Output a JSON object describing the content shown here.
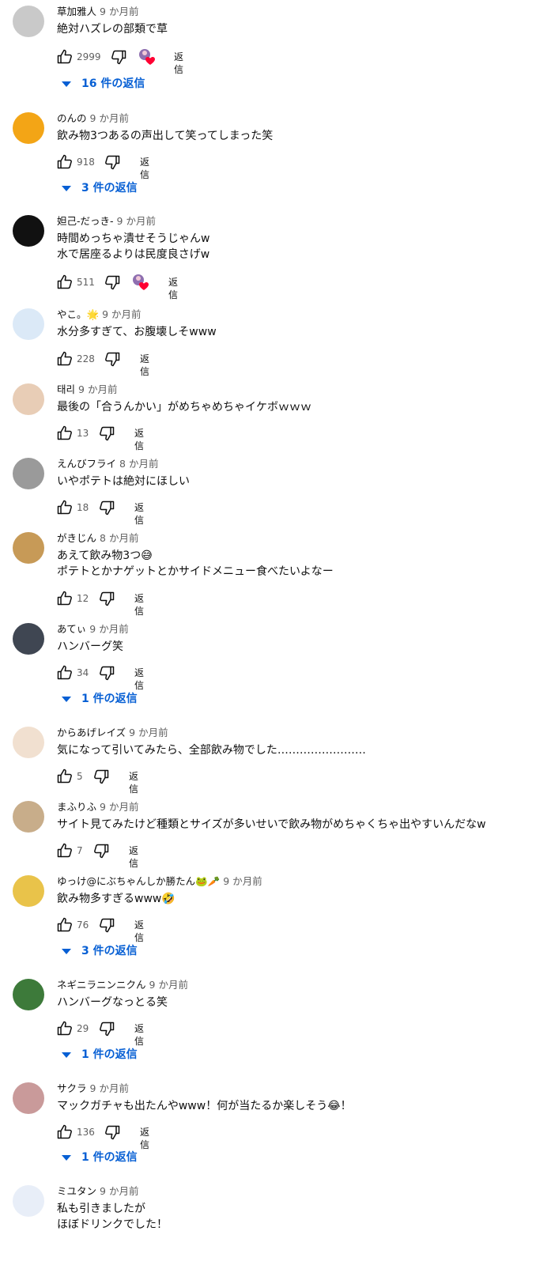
{
  "labels": {
    "reply": "返信"
  },
  "comments": [
    {
      "author": "草加雅人",
      "time": "9 か月前",
      "lines": [
        "絶対ハズレの部類で草"
      ],
      "likes": "2999",
      "creator_heart": true,
      "replies": "16 件の返信",
      "avatar_color": "#c9c9c9"
    },
    {
      "author": "のんの",
      "time": "9 か月前",
      "lines": [
        "飲み物3つあるの声出して笑ってしまった笑"
      ],
      "likes": "918",
      "creator_heart": false,
      "replies": "3 件の返信",
      "avatar_color": "#f3a516"
    },
    {
      "author": "妲己-だっき-",
      "time": "9 か月前",
      "lines": [
        "時間めっちゃ潰せそうじゃんw",
        "水で居座るよりは民度良さげw"
      ],
      "likes": "511",
      "creator_heart": true,
      "replies": "",
      "avatar_color": "#111111"
    },
    {
      "author": "やこ。🌟",
      "time": "9 か月前",
      "lines": [
        "水分多すぎて、お腹壊しそwww"
      ],
      "likes": "228",
      "creator_heart": false,
      "replies": "",
      "avatar_color": "#dbe9f7"
    },
    {
      "author": "태리",
      "time": "9 か月前",
      "lines": [
        "最後の「合うんかい」がめちゃめちゃイケボｗｗｗ"
      ],
      "likes": "13",
      "creator_heart": false,
      "replies": "",
      "avatar_color": "#e8cdb6"
    },
    {
      "author": "えんびフライ",
      "time": "8 か月前",
      "lines": [
        "いやポテトは絶対にほしい"
      ],
      "likes": "18",
      "creator_heart": false,
      "replies": "",
      "avatar_color": "#9a9a9a"
    },
    {
      "author": "がきじん",
      "time": "8 か月前",
      "lines": [
        "あえて飲み物3つ😅",
        "ポテトとかナゲットとかサイドメニュー食べたいよなー"
      ],
      "likes": "12",
      "creator_heart": false,
      "replies": "",
      "avatar_color": "#c79a57"
    },
    {
      "author": "あてぃ",
      "time": "9 か月前",
      "lines": [
        "ハンバーグ笑"
      ],
      "likes": "34",
      "creator_heart": false,
      "replies": "1 件の返信",
      "avatar_color": "#3f4652"
    },
    {
      "author": "からあげレイズ",
      "time": "9 か月前",
      "lines": [
        "気になって引いてみたら、全部飲み物でした……………………"
      ],
      "likes": "5",
      "creator_heart": false,
      "replies": "",
      "avatar_color": "#f1e0d0"
    },
    {
      "author": "まふりふ",
      "time": "9 か月前",
      "lines": [
        "サイト見てみたけど種類とサイズが多いせいで飲み物がめちゃくちゃ出やすいんだなw"
      ],
      "likes": "7",
      "creator_heart": false,
      "replies": "",
      "avatar_color": "#c8ad8a"
    },
    {
      "author": "ゆっけ@にぶちゃんしか勝たん🐸🥕",
      "time": "9 か月前",
      "lines": [
        "飲み物多すぎるwww🤣"
      ],
      "likes": "76",
      "creator_heart": false,
      "replies": "3 件の返信",
      "avatar_color": "#e9c34a"
    },
    {
      "author": "ネギニラニンニクん",
      "time": "9 か月前",
      "lines": [
        "ハンバーグなっとる笑"
      ],
      "likes": "29",
      "creator_heart": false,
      "replies": "1 件の返信",
      "avatar_color": "#3d7a3a"
    },
    {
      "author": "サクラ",
      "time": "9 か月前",
      "lines": [
        "マックガチャも出たんやwww！何が当たるか楽しそう😂！"
      ],
      "likes": "136",
      "creator_heart": false,
      "replies": "1 件の返信",
      "avatar_color": "#c99a9a"
    },
    {
      "author": "ミユタン",
      "time": "9 か月前",
      "lines": [
        "私も引きましたが",
        "ほぼドリンクでした！"
      ],
      "likes": "",
      "creator_heart": false,
      "replies": "",
      "avatar_color": "#e8eef8"
    }
  ]
}
